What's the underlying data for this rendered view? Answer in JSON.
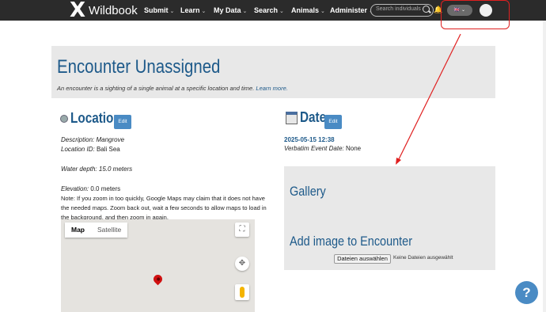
{
  "nav": {
    "brand": "Wildbook",
    "logo_glyph": "X",
    "items": [
      {
        "label": "Submit",
        "chevron": "⌄"
      },
      {
        "label": "Learn",
        "chevron": "⌄"
      },
      {
        "label": "My Data",
        "chevron": "⌄"
      },
      {
        "label": "Search",
        "chevron": "⌄"
      },
      {
        "label": "Animals",
        "chevron": "⌄"
      },
      {
        "label": "Administer",
        "chevron": "⌄"
      }
    ],
    "search_placeholder": "Search individuals",
    "language": "🇬🇧 ⌄"
  },
  "header": {
    "title": "Encounter Unassigned",
    "subtitle": "An encounter is a sighting of a single animal at a specific location and time.",
    "learn_more": "Learn more."
  },
  "location": {
    "heading": "Location",
    "edit_label": "Edit",
    "description_label": "Description:",
    "description_value": "Mangrove",
    "location_id_label": "Location ID:",
    "location_id_value": "Bali Sea",
    "water_depth": "Water depth: 15.0 meters",
    "elevation_label": "Elevation:",
    "elevation_value": "0.0 meters",
    "note": "Note: If you zoom in too quickly, Google Maps may claim that it does not have the needed maps. Zoom back out, wait a few seconds to allow maps to load in the background, and then zoom in again."
  },
  "map": {
    "tabs": [
      "Map",
      "Satellite"
    ],
    "fullscreen_glyph": "⛶",
    "pan_glyph": "✥"
  },
  "date": {
    "heading": "Date",
    "edit_label": "Edit",
    "date_value": "2025-05-15 12:38",
    "verbatim_label": "Verbatim Event Date:",
    "verbatim_value": "None"
  },
  "gallery": {
    "heading": "Gallery",
    "add_image_heading": "Add image to Encounter",
    "file_button": "Dateien auswählen",
    "file_status": "Keine Dateien ausgewählt"
  },
  "help": {
    "glyph": "?"
  },
  "colors": {
    "annotation": "#e02020",
    "accent": "#1e5a8a",
    "button": "#4a8bc4"
  }
}
